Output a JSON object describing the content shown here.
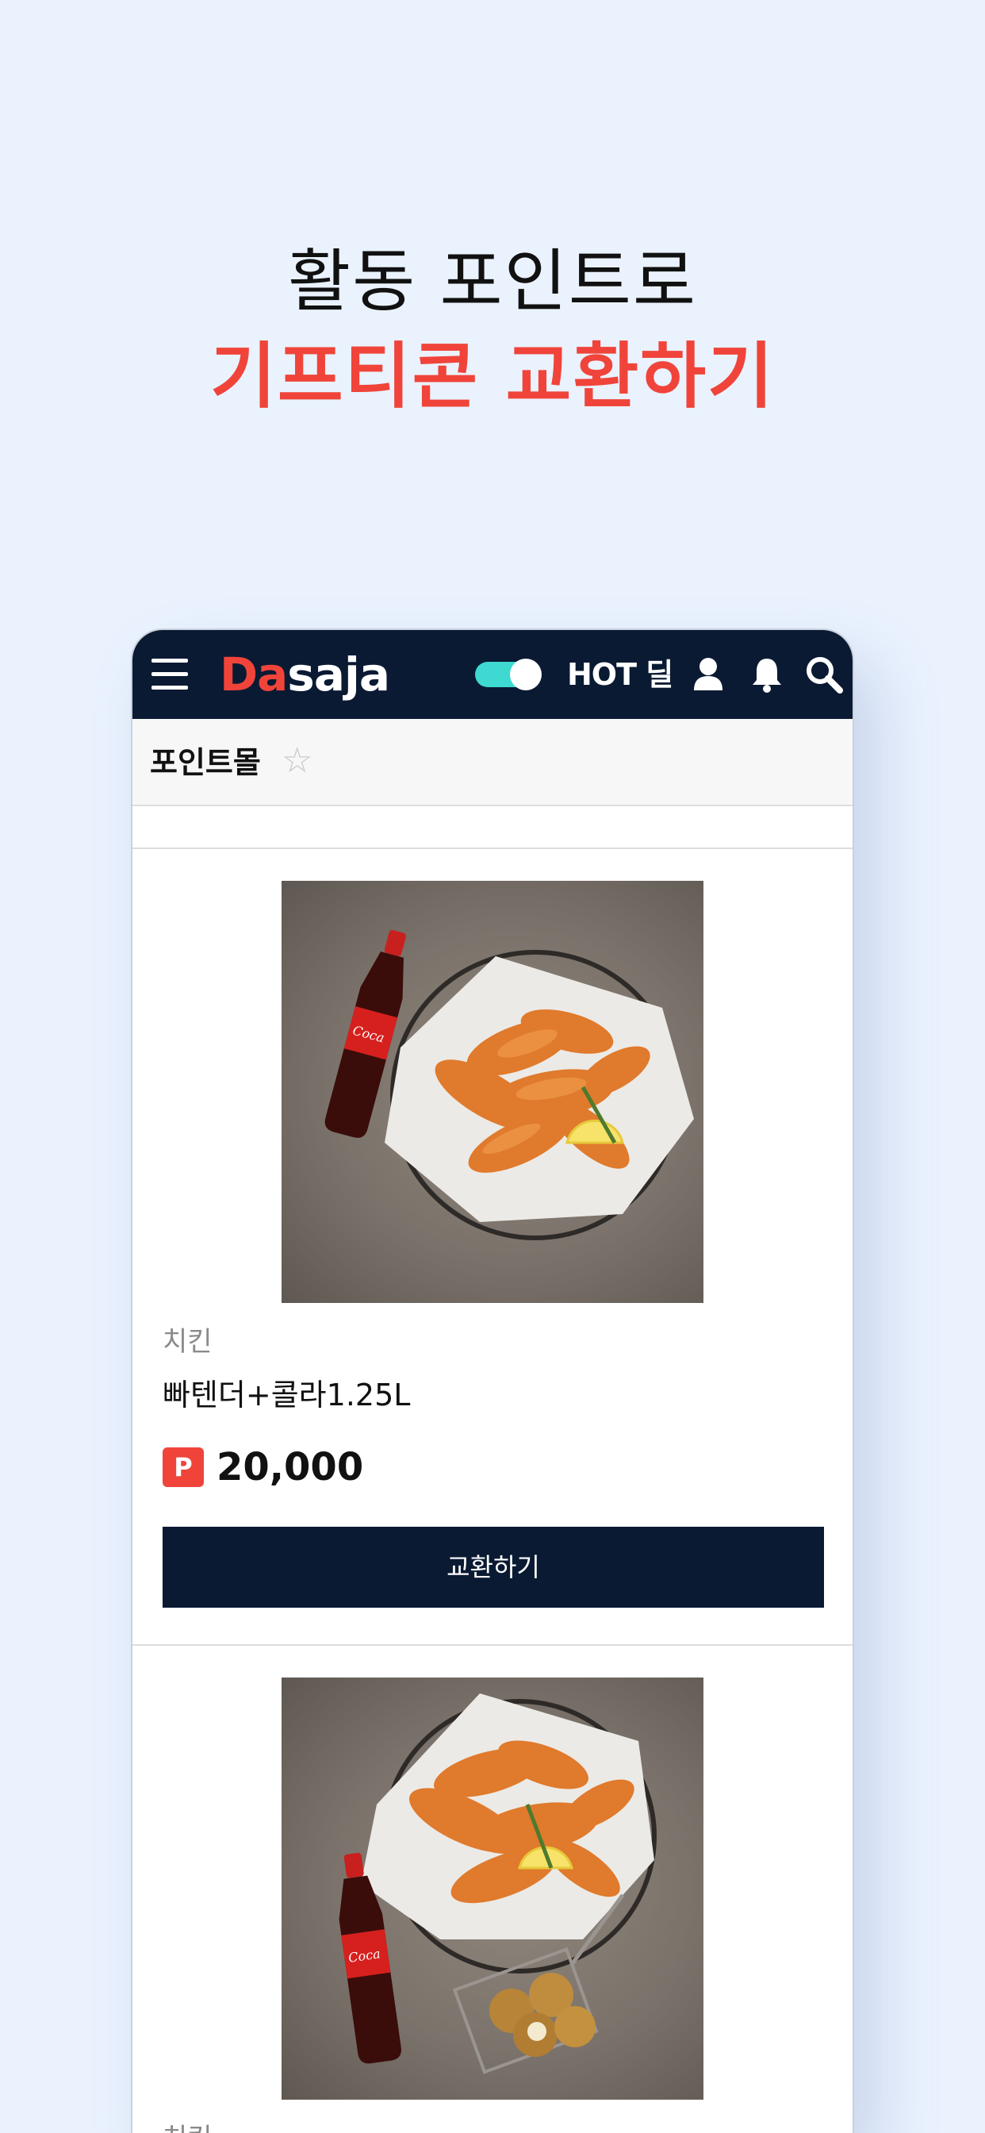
{
  "headline": {
    "line1": "활동 포인트로",
    "line2": "기프티콘 교환하기"
  },
  "appbar": {
    "logo_mark": "Da",
    "logo_text": "saja",
    "hot_label": "HOT 딜",
    "icons": [
      "hamburger-menu-icon",
      "user-icon",
      "bell-icon",
      "search-icon"
    ]
  },
  "subheader": {
    "title": "포인트몰",
    "star": "☆"
  },
  "products": [
    {
      "category": "치킨",
      "name": "빠텐더+콜라1.25L",
      "point_badge": "P",
      "price": "20,000",
      "button_label": "교환하기"
    },
    {
      "category": "치킨"
    }
  ],
  "colors": {
    "background": "#EAF2FE",
    "accent_red": "#F0443A",
    "navy": "#0A1A33",
    "toggle_teal": "#3ED9D0"
  }
}
